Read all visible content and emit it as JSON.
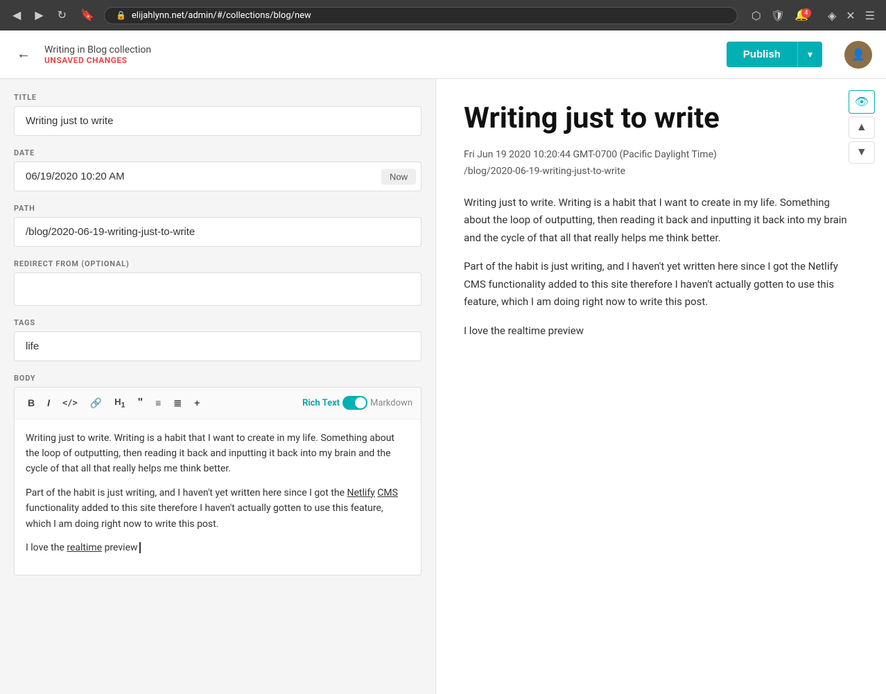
{
  "browser": {
    "url": "elijahlynn.net/admin/#/collections/blog/new",
    "nav_back": "◀",
    "nav_forward": "▶",
    "nav_refresh": "↻",
    "nav_bookmark": "🔖"
  },
  "header": {
    "collection_name": "Writing in Blog collection",
    "unsaved_label": "UNSAVED CHANGES",
    "back_icon": "←",
    "publish_label": "Publish",
    "dropdown_icon": "▾"
  },
  "fields": {
    "title_label": "TITLE",
    "title_value": "Writing just to write",
    "date_label": "DATE",
    "date_value": "06/19/2020 10:20 AM",
    "now_label": "Now",
    "path_label": "PATH",
    "path_value": "/blog/2020-06-19-writing-just-to-write",
    "redirect_label": "REDIRECT FROM (OPTIONAL)",
    "redirect_value": "",
    "tags_label": "TAGS",
    "tags_value": "life",
    "body_label": "BODY"
  },
  "toolbar": {
    "bold": "B",
    "italic": "I",
    "code": "</>",
    "link": "🔗",
    "heading": "H₁",
    "quote": "❝",
    "ul": "☰",
    "ol": "☱",
    "more": "+",
    "rich_text_label": "Rich Text",
    "markdown_label": "Markdown"
  },
  "body_content": {
    "para1": "Writing just to write. Writing is a habit that I want to create in my life. Something about the loop of outputting, then reading it back and inputting it back into my brain and the cycle of that all that really helps me think better.",
    "para2_before": "Part of the habit is just writing, and I haven't yet written here since I got the ",
    "netlify_link": "Netlify",
    "cms_link": "CMS",
    "para2_after": " functionality added to this site therefore I haven't actually gotten to use this feature, which I am doing right now to write this post.",
    "para3_before": "I love the ",
    "realtime_link": "realtime",
    "para3_after": " preview"
  },
  "preview": {
    "title": "Writing just to write",
    "date_path": "Fri Jun 19 2020 10:20:44 GMT-0700 (Pacific Daylight Time)\n/blog/2020-06-19-writing-just-to-write",
    "para1": "Writing just to write. Writing is a habit that I want to create in my life. Something about the loop of outputting, then reading it back and inputting it back into my brain and the cycle of that all that really helps me think better.",
    "para2": "Part of the habit is just writing, and I haven't yet written here since I got the Netlify CMS functionality added to this site therefore I haven't actually gotten to use this feature, which I am doing right now to write this post.",
    "para3": "I love the realtime preview"
  },
  "icons": {
    "eye": "👁",
    "move_up": "▲",
    "move_down": "▼"
  }
}
